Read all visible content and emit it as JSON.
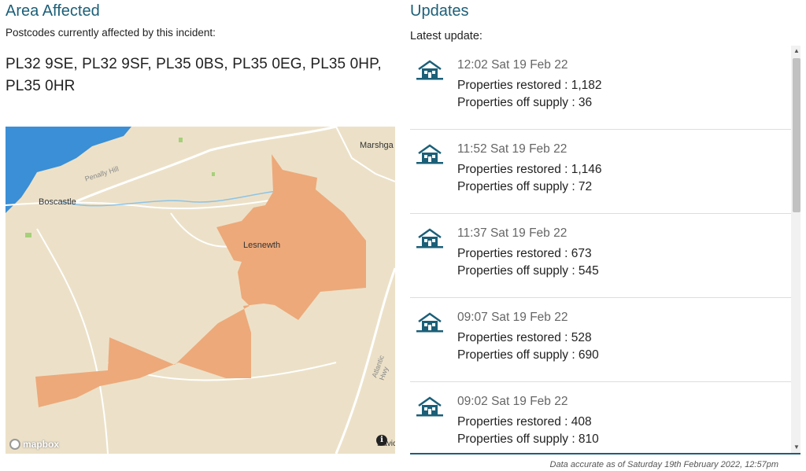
{
  "area": {
    "title": "Area Affected",
    "subtitle": "Postcodes currently affected by this incident:",
    "postcodes": "PL32 9SE, PL32 9SF, PL35 0BS, PL35 0EG, PL35 0HP, PL35 0HR"
  },
  "map": {
    "labels": {
      "boscastle": "Boscastle",
      "lesnewth": "Lesnewth",
      "marshgate": "Marshga",
      "penally_hill": "Penally Hill",
      "atlantic_hwy": "Atlantic Hwy",
      "davidstow": "Davic"
    },
    "logo": "mapbox",
    "info_icon": "i",
    "colors": {
      "land": "#ece1c8",
      "sea": "#3a8fd6",
      "affected": "#eda97a"
    }
  },
  "updates": {
    "title": "Updates",
    "latest_label": "Latest update:",
    "items": [
      {
        "time": "12:02 Sat 19 Feb 22",
        "restored": "Properties restored : 1,182",
        "off": "Properties off supply : 36"
      },
      {
        "time": "11:52 Sat 19 Feb 22",
        "restored": "Properties restored : 1,146",
        "off": "Properties off supply : 72"
      },
      {
        "time": "11:37 Sat 19 Feb 22",
        "restored": "Properties restored : 673",
        "off": "Properties off supply : 545"
      },
      {
        "time": "09:07 Sat 19 Feb 22",
        "restored": "Properties restored : 528",
        "off": "Properties off supply : 690"
      },
      {
        "time": "09:02 Sat 19 Feb 22",
        "restored": "Properties restored : 408",
        "off": "Properties off supply : 810"
      }
    ],
    "icon": "house-icon"
  },
  "footer": {
    "accuracy": "Data accurate as of Saturday 19th February 2022, 12:57pm"
  },
  "colors": {
    "accent": "#1b5f78"
  }
}
